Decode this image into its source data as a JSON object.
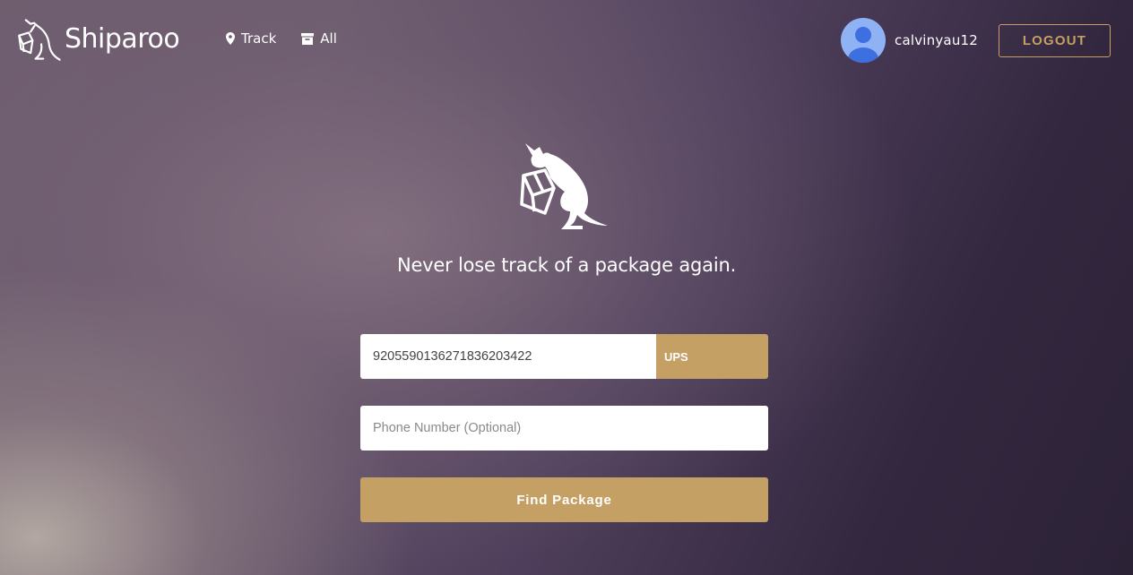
{
  "header": {
    "brand_name": "Shiparoo",
    "brand_icon": "kangaroo-with-box-icon",
    "nav": [
      {
        "label": "Track",
        "icon": "map-pin-icon"
      },
      {
        "label": "All",
        "icon": "archive-box-icon"
      }
    ],
    "user": {
      "username": "calvinyau12",
      "avatar_icon": "default-user-avatar-icon"
    },
    "logout_label": "LOGOUT"
  },
  "hero": {
    "icon": "kangaroo-with-box-icon",
    "tagline": "Never lose track of a package again."
  },
  "form": {
    "tracking_number": "9205590136271836203422",
    "carrier": "UPS",
    "phone_placeholder": "Phone Number (Optional)",
    "submit_label": "Find Package"
  },
  "colors": {
    "accent": "#c5a064",
    "avatar_bg": "#8fb2f5",
    "avatar_figure": "#3d6fe0"
  }
}
